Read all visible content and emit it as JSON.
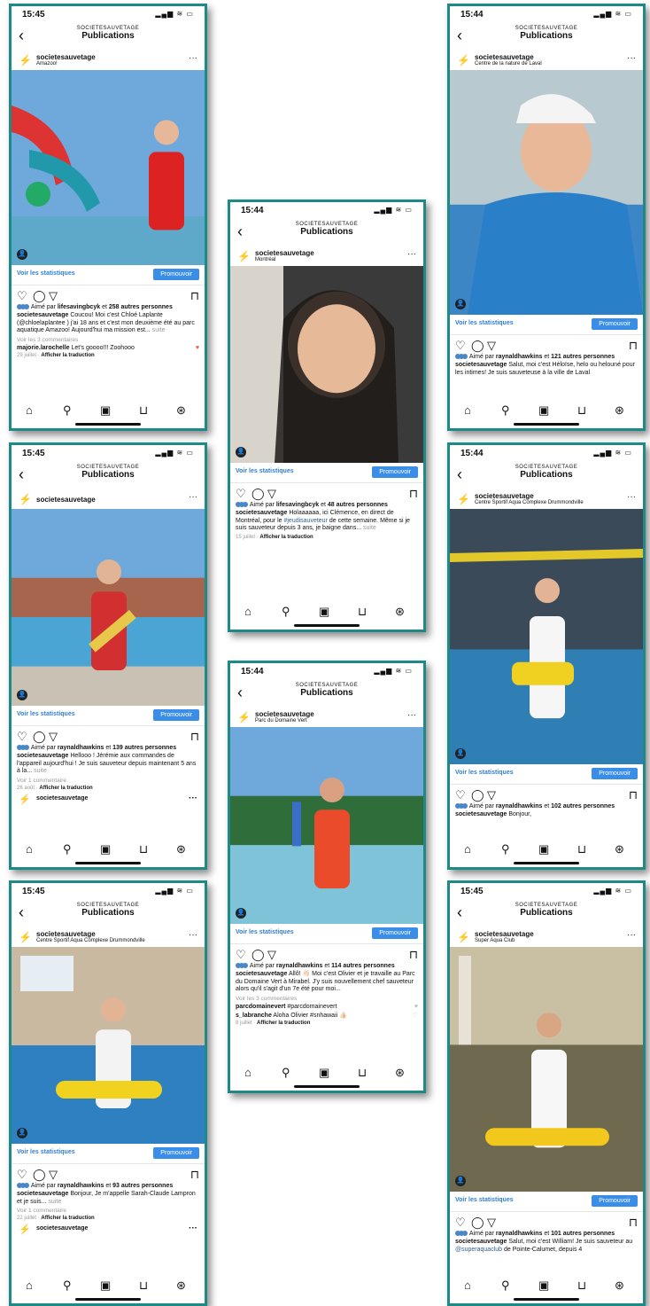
{
  "common": {
    "account": "SOCIETESAUVETAGE",
    "title": "Publications",
    "username": "societesauvetage",
    "stats": "Voir les statistiques",
    "promote": "Promouvoir",
    "aime_par": "Aimé par",
    "et": "et",
    "translate": "Afficher la traduction",
    "suite": "suite"
  },
  "posts": [
    {
      "time": "15:45",
      "location": "Amazoo!",
      "liker": "lifesavingbcyk",
      "others": "258 autres personnes",
      "caption": "Coucou! Moi c'est Chloé Laplante",
      "caption2": "(@chloelaplantee ) j'ai 18 ans et c'est mon deuxième été au parc aquatique Amazoo! Aujourd'hui ma mission est...",
      "comments": "Voir les 3 commentaires",
      "c_user": "majorie.larochelle",
      "c_text": "Let's goooo!!! Zoohooo",
      "date": "29 juillet"
    },
    {
      "time": "15:44",
      "location": "Montréal",
      "liker": "lifesavingbcyk",
      "others": "48 autres personnes",
      "caption": "Holaaaaaa, ici Clémence, en direct de Montréal, pour le",
      "mention": "#jeudisauveteur",
      "caption2": "de cette semaine. Même si je suis sauveteur depuis 3 ans, je baigne dans...",
      "date": "15 juillet"
    },
    {
      "time": "15:44",
      "location": "Centre de la nature de Laval",
      "liker": "raynaldhawkins",
      "others": "121 autres personnes",
      "caption": "Salut, moi c'est Héloïse, helo ou helouné pour les intimes! Je suis sauveteuse à la ville de Laval"
    },
    {
      "time": "15:45",
      "liker": "raynaldhawkins",
      "others": "139 autres personnes",
      "caption": "Hellooo ! Jérémie aux commandes de l'appareil aujourd'hui !",
      "caption2": "Je suis sauveteur depuis maintenant 5 ans à la...",
      "comments": "Voir 1 commentaire",
      "date": "26 août",
      "next": "societesauvetage"
    },
    {
      "time": "15:44",
      "location": "Parc du Domaine Vert",
      "liker": "raynaldhawkins",
      "others": "114 autres personnes",
      "caption": "Allô! 👋🏻 Moi c'est Olivier et je travaille au Parc du Domaine Vert à Mirabel. J'y suis nouvellement chef sauveteur alors qu'il s'agit d'un 7e été pour moi...",
      "comments": "Voir les 3 commentaires",
      "c_user": "parcdomainevert",
      "c_text": "#parcdomainevert",
      "c2_user": "s_labranche",
      "c2_text": "Aloha Olivier #snhawaii 👍🏻",
      "date": "8 juillet"
    },
    {
      "time": "15:44",
      "location": "Centre Sportif Aqua Complexe Drummondville",
      "liker": "raynaldhawkins",
      "others": "102 autres personnes",
      "caption": "Bonjour,"
    },
    {
      "time": "15:45",
      "location": "Centre Sportif Aqua Complexe Drummondville",
      "liker": "raynaldhawkins",
      "others": "93 autres personnes",
      "caption": "Bonjour,",
      "caption2": "Je m'appelle Sarah-Claude Lampron et je suis...",
      "comments": "Voir 1 commentaire",
      "date": "22 juillet",
      "next": "societesauvetage"
    },
    {
      "time": "15:45",
      "location": "Super Aqua Club",
      "liker": "raynaldhawkins",
      "others": "101 autres personnes",
      "caption": "Salut, moi c'est William! Je suis sauveteur au",
      "mention": "@superaquaclub",
      "caption2": "de Pointe-Calumet, depuis 4"
    }
  ]
}
